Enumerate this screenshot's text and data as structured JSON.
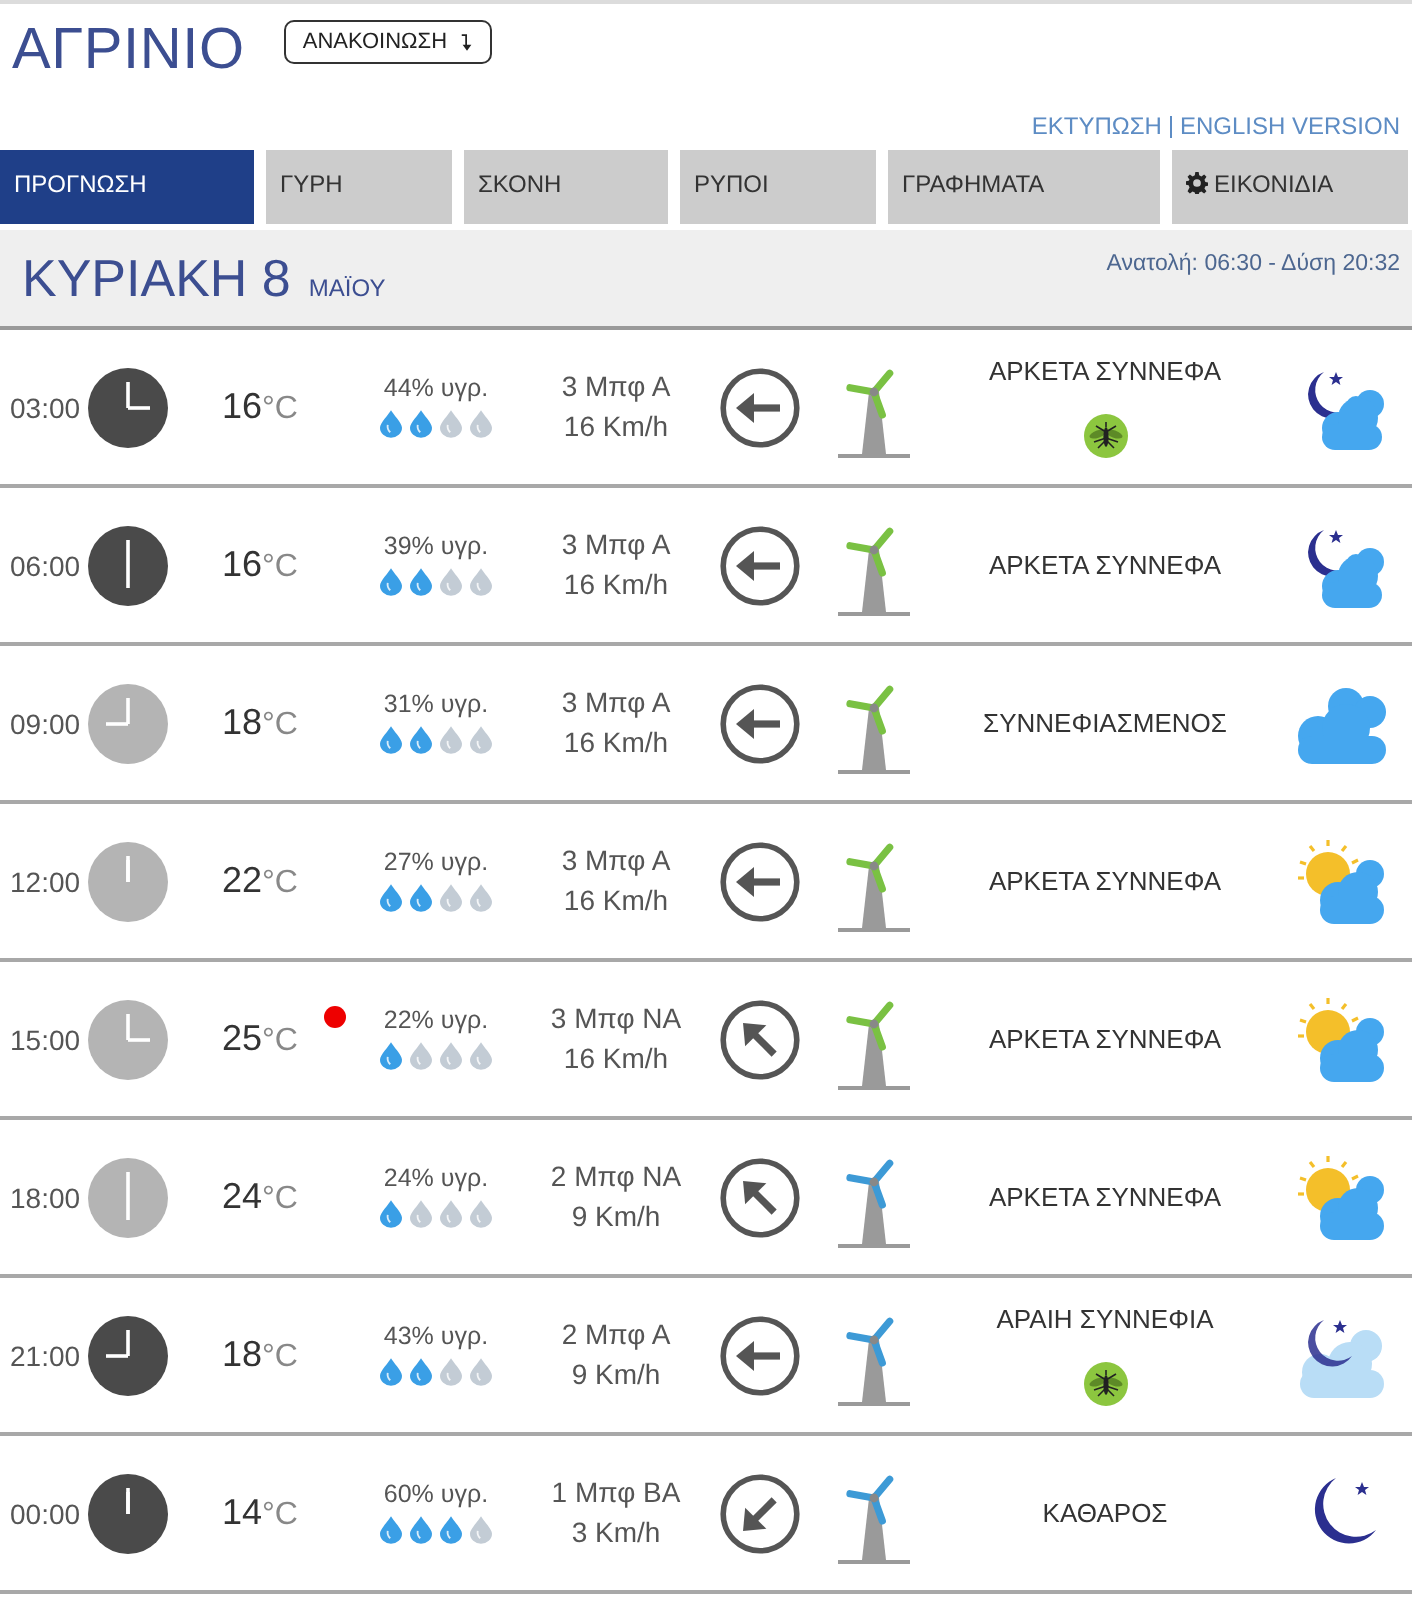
{
  "header": {
    "city": "ΑΓΡΙΝΙΟ",
    "announcement_button": "ΑΝΑΚΟΙΝΩΣΗ",
    "links": [
      "ΕΚΤΥΠΩΣΗ",
      "ENGLISH VERSION"
    ]
  },
  "tabs": [
    {
      "label": "ΠΡΟΓΝΩΣΗ",
      "selected": true,
      "kind": "text"
    },
    {
      "label": "ΓΥΡΗ",
      "selected": false,
      "kind": "text"
    },
    {
      "label": "ΣΚΟΝΗ",
      "selected": false,
      "kind": "text"
    },
    {
      "label": "ΡΥΠΟΙ",
      "selected": false,
      "kind": "text"
    },
    {
      "label": "ΓΡΑΦΗΜΑΤΑ",
      "selected": false,
      "kind": "text"
    },
    {
      "label": "ΕΙΚΟΝΙΔΙΑ",
      "selected": false,
      "kind": "gear"
    }
  ],
  "day": {
    "title": "ΚΥΡΙΑΚΗ 8",
    "month": "ΜΑΪΟΥ",
    "sun_times": "Ανατολή: 06:30  - Δύση 20:32"
  },
  "hours": [
    {
      "time": "03:00",
      "night": true,
      "temperature": "**16**°C",
      "alert": false,
      "humidity": "44% υγρ.",
      "stars": 2,
      "wind_force": "3 Μπφ Α",
      "wind_speed": "16 Km/h",
      "wind_arrow": {
        "kind": "w"
      },
      "color": "#7ac143",
      "condition": "ΑΡΚΕΤΑ ΣΥΝΝΕΦΑ",
      "mosquito": true,
      "sky_icon": {
        "kind": "night_cloudy"
      }
    },
    {
      "time": "06:00",
      "night": true,
      "temperature": "**16**°C",
      "alert": false,
      "humidity": "39% υγρ.",
      "stars": 2,
      "wind_force": "3 Μπφ Α",
      "wind_speed": "16 Km/h",
      "wind_arrow": {
        "kind": "w"
      },
      "color": "#7ac143",
      "condition": "ΑΡΚΕΤΑ ΣΥΝΝΕΦΑ",
      "mosquito": false,
      "sky_icon": {
        "kind": "night_cloudy"
      }
    },
    {
      "time": "09:00",
      "night": false,
      "temperature": "**18**°C",
      "alert": false,
      "humidity": "31% υγρ.",
      "stars": 2,
      "wind_force": "3 Μπφ Α",
      "wind_speed": "16 Km/h",
      "wind_arrow": {
        "kind": "w"
      },
      "color": "#7ac143",
      "condition": "ΣΥΝΝΕΦΙΑΣΜΕΝΟΣ",
      "mosquito": false,
      "sky_icon": {
        "kind": "cloudy"
      }
    },
    {
      "time": "12:00",
      "night": false,
      "temperature": "**22**°C",
      "alert": false,
      "humidity": "27% υγρ.",
      "stars": 2,
      "wind_force": "3 Μπφ Α",
      "wind_speed": "16 Km/h",
      "wind_arrow": {
        "kind": "w"
      },
      "color": "#7ac143",
      "condition": "ΑΡΚΕΤΑ ΣΥΝΝΕΦΑ",
      "mosquito": false,
      "sky_icon": {
        "kind": "sun_cloudy"
      }
    },
    {
      "time": "15:00",
      "night": false,
      "temperature": "**25**°C",
      "alert": true,
      "humidity": "22% υγρ.",
      "stars": 1,
      "wind_force": "3 Μπφ ΝΑ",
      "wind_speed": "16 Km/h",
      "wind_arrow": {
        "kind": "nw"
      },
      "color": "#7ac143",
      "condition": "ΑΡΚΕΤΑ ΣΥΝΝΕΦΑ",
      "mosquito": false,
      "sky_icon": {
        "kind": "sun_cloudy"
      }
    },
    {
      "time": "18:00",
      "night": false,
      "temperature": "**24**°C",
      "alert": false,
      "humidity": "24% υγρ.",
      "stars": 1,
      "wind_force": "2 Μπφ ΝΑ",
      "wind_speed": "9 Km/h",
      "wind_arrow": {
        "kind": "nw"
      },
      "color": "#3d9ad6",
      "condition": "ΑΡΚΕΤΑ ΣΥΝΝΕΦΑ",
      "mosquito": false,
      "sky_icon": {
        "kind": "sun_cloudy"
      }
    },
    {
      "time": "21:00",
      "night": true,
      "temperature": "**18**°C",
      "alert": false,
      "humidity": "43% υγρ.",
      "stars": 2,
      "wind_force": "2 Μπφ Α",
      "wind_speed": "9 Km/h",
      "wind_arrow": {
        "kind": "w"
      },
      "color": "#3d9ad6",
      "condition": "ΑΡΑΙΗ ΣΥΝΝΕΦΙΑ",
      "mosquito": true,
      "sky_icon": {
        "kind": "night_few_clouds"
      }
    },
    {
      "time": "00:00",
      "night": true,
      "temperature": "**14**°C",
      "alert": false,
      "humidity": "60% υγρ.",
      "stars": 3,
      "wind_force": "1 Μπφ ΒΑ",
      "wind_speed": "3 Km/h",
      "wind_arrow": {
        "kind": "sw"
      },
      "color": "#3d9ad6",
      "condition": "ΚΑΘΑΡΟΣ",
      "mosquito": false,
      "sky_icon": {
        "kind": "clear_night"
      }
    }
  ]
}
